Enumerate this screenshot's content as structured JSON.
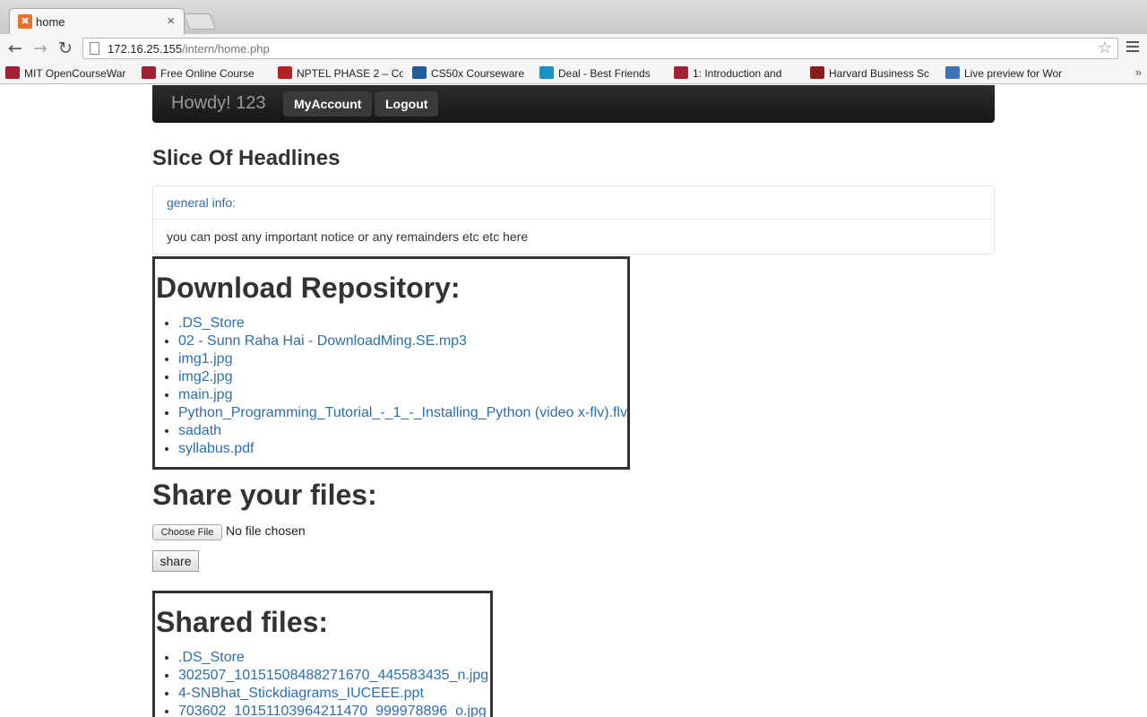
{
  "browser": {
    "tab_title": "home",
    "url_host": "172.16.25.155",
    "url_path": "/intern/home.php",
    "bookmarks": [
      {
        "label": "MIT OpenCourseWar",
        "icon": "mit-ocw-icon",
        "color": "#a31f34"
      },
      {
        "label": "Free Online Course",
        "icon": "mit-ocw-icon",
        "color": "#a31f34"
      },
      {
        "label": "NPTEL PHASE 2 – Co",
        "icon": "nptel-icon",
        "color": "#b22222"
      },
      {
        "label": "CS50x Courseware",
        "icon": "edx-icon",
        "color": "#1f5c99"
      },
      {
        "label": "Deal - Best Friends",
        "icon": "m-icon",
        "color": "#1a8fc8"
      },
      {
        "label": "1: Introduction and",
        "icon": "mit-ocw-icon",
        "color": "#a31f34"
      },
      {
        "label": "Harvard Business Sc",
        "icon": "harvard-icon",
        "color": "#8b1c1c"
      },
      {
        "label": "Live preview for Wor",
        "icon": "preview-icon",
        "color": "#3b73b9"
      }
    ]
  },
  "navbar": {
    "brand": "Howdy! 123",
    "account_label": "MyAccount",
    "logout_label": "Logout"
  },
  "headline": "Slice Of Headlines",
  "panel": {
    "heading": "general info:",
    "body": "you can post any important notice or any remainders etc etc here"
  },
  "download": {
    "title": "Download Repository:",
    "files": [
      ".DS_Store",
      "02 - Sunn Raha Hai - DownloadMing.SE.mp3",
      "img1.jpg",
      "img2.jpg",
      "main.jpg",
      "Python_Programming_Tutorial_-_1_-_Installing_Python (video x-flv).flv",
      "sadath",
      "syllabus.pdf"
    ]
  },
  "share": {
    "title": "Share your files:",
    "choose_label": "Choose File",
    "status": "No file chosen",
    "submit_label": "share"
  },
  "shared": {
    "title": "Shared files:",
    "files": [
      ".DS_Store",
      "302507_10151508488271670_445583435_n.jpg",
      "4-SNBhat_Stickdiagrams_IUCEEE.ppt",
      "703602_10151103964211470_999978896_o.jpg"
    ]
  }
}
